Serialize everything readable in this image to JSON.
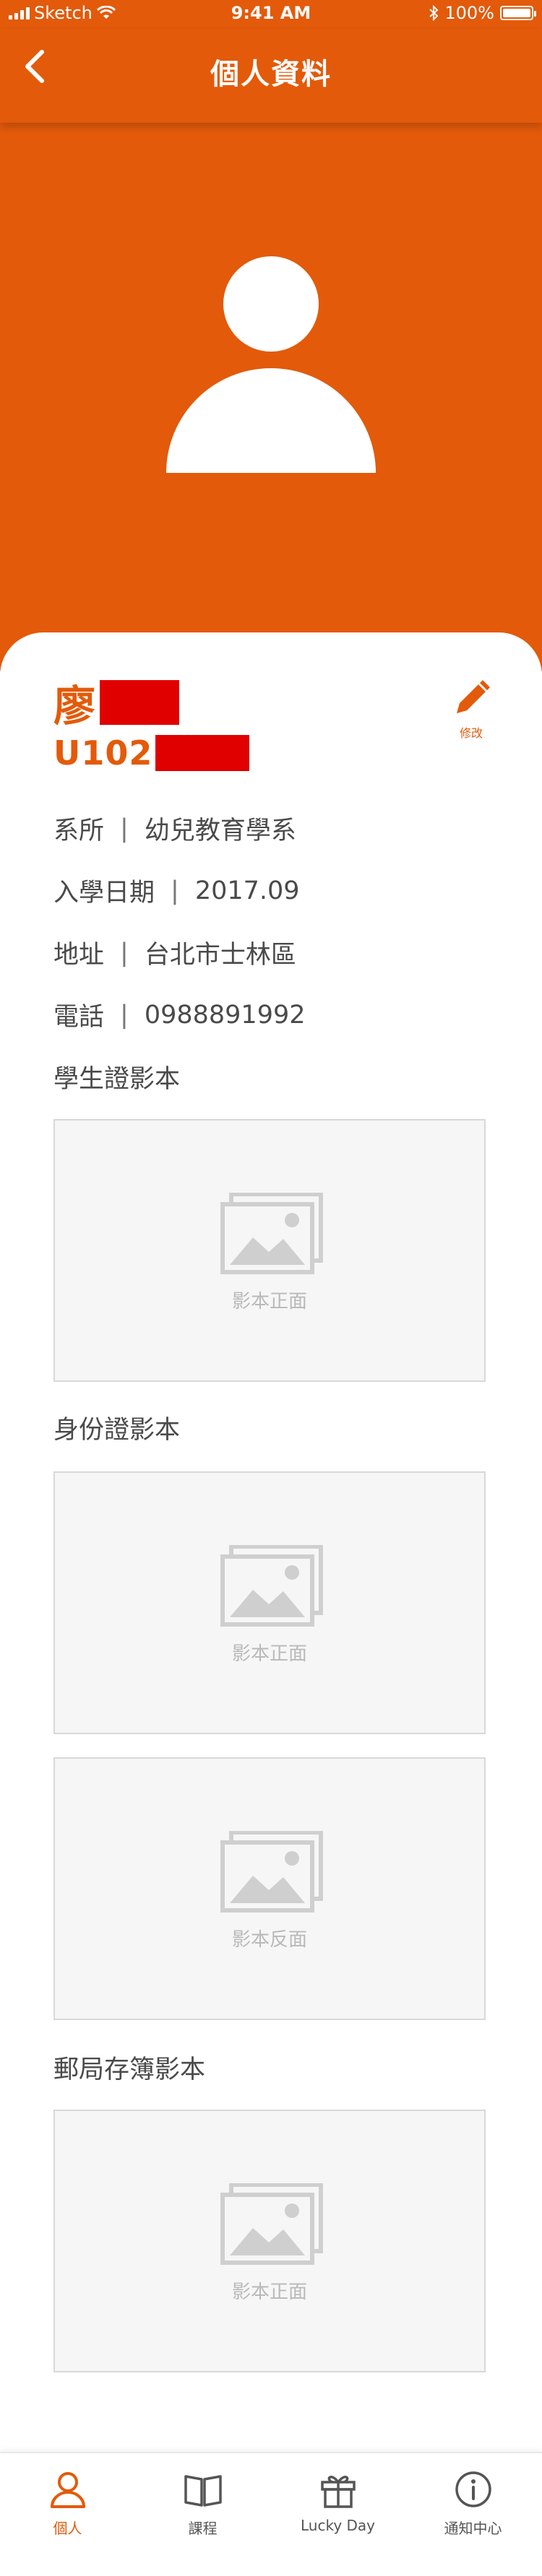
{
  "status_bar": {
    "carrier": "Sketch",
    "time": "9:41 AM",
    "battery": "100%"
  },
  "header": {
    "title": "個人資料"
  },
  "profile": {
    "name": "廖",
    "student_id": "U102",
    "edit_label": "修改",
    "fields": [
      {
        "label": "系所",
        "value": "幼兒教育學系"
      },
      {
        "label": "入學日期",
        "value": "2017.09"
      },
      {
        "label": "地址",
        "value": "台北市士林區"
      },
      {
        "label": "電話",
        "value": "0988891992"
      }
    ]
  },
  "sections": {
    "student_card": {
      "title": "學生證影本",
      "front": "影本正面"
    },
    "id_card": {
      "title": "身份證影本",
      "front": "影本正面",
      "back": "影本反面"
    },
    "passbook": {
      "title": "郵局存簿影本",
      "front": "影本正面"
    }
  },
  "tabs": [
    {
      "label": "個人",
      "icon": "person-icon",
      "active": true
    },
    {
      "label": "課程",
      "icon": "book-icon",
      "active": false
    },
    {
      "label": "Lucky Day",
      "icon": "gift-icon",
      "active": false
    },
    {
      "label": "通知中心",
      "icon": "info-icon",
      "active": false
    }
  ],
  "colors": {
    "accent": "#E35A0A",
    "redaction": "#E00000",
    "placeholder_bg": "#F6F6F6"
  }
}
